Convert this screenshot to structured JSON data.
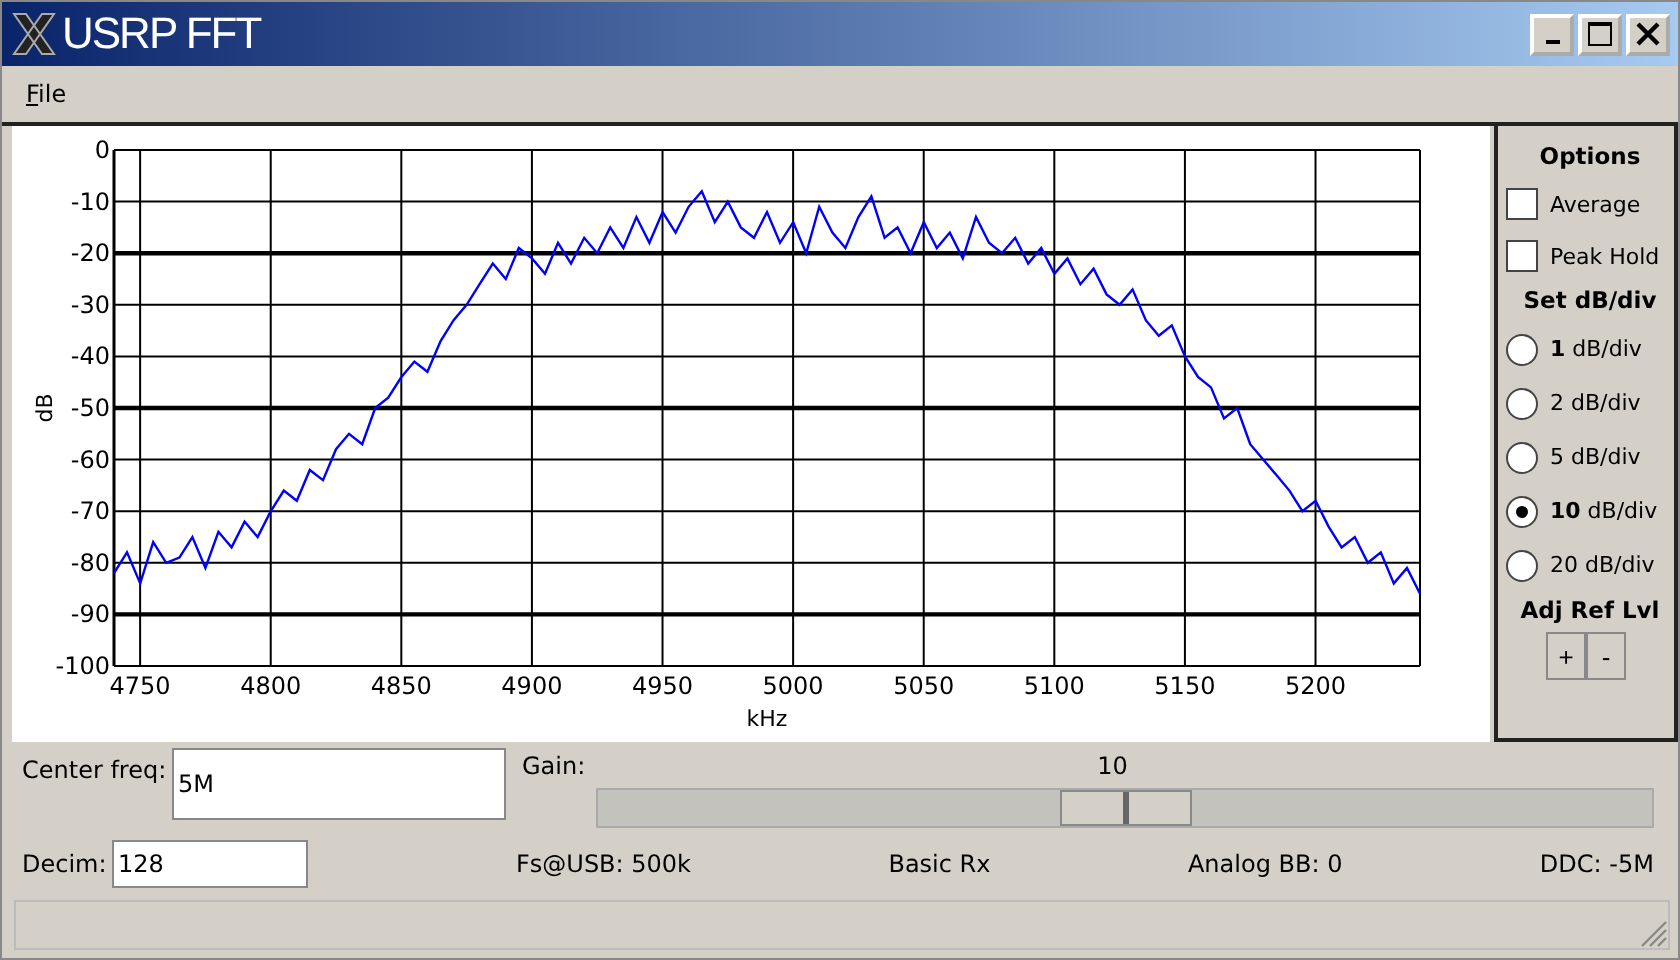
{
  "window": {
    "title": "USRP FFT"
  },
  "menu": [
    {
      "label": "File"
    }
  ],
  "chart_data": {
    "type": "line",
    "xlabel": "kHz",
    "ylabel": "dB",
    "x": [
      4740,
      4745,
      4750,
      4755,
      4760,
      4765,
      4770,
      4775,
      4780,
      4785,
      4790,
      4795,
      4800,
      4805,
      4810,
      4815,
      4820,
      4825,
      4830,
      4835,
      4840,
      4845,
      4850,
      4855,
      4860,
      4865,
      4870,
      4875,
      4880,
      4885,
      4890,
      4895,
      4900,
      4905,
      4910,
      4915,
      4920,
      4925,
      4930,
      4935,
      4940,
      4945,
      4950,
      4955,
      4960,
      4965,
      4970,
      4975,
      4980,
      4985,
      4990,
      4995,
      5000,
      5005,
      5010,
      5015,
      5020,
      5025,
      5030,
      5035,
      5040,
      5045,
      5050,
      5055,
      5060,
      5065,
      5070,
      5075,
      5080,
      5085,
      5090,
      5095,
      5100,
      5105,
      5110,
      5115,
      5120,
      5125,
      5130,
      5135,
      5140,
      5145,
      5150,
      5155,
      5160,
      5165,
      5170,
      5175,
      5180,
      5185,
      5190,
      5195,
      5200,
      5205,
      5210,
      5215,
      5220,
      5225,
      5230,
      5235,
      5240
    ],
    "grid": true,
    "series": [
      {
        "color": "#0000ff",
        "values": [
          -82,
          -78,
          -84,
          -76,
          -80,
          -79,
          -75,
          -81,
          -74,
          -77,
          -72,
          -75,
          -70,
          -66,
          -68,
          -62,
          -64,
          -58,
          -55,
          -57,
          -50,
          -48,
          -44,
          -41,
          -43,
          -37,
          -33,
          -30,
          -26,
          -22,
          -25,
          -19,
          -21,
          -24,
          -18,
          -22,
          -17,
          -20,
          -15,
          -19,
          -13,
          -18,
          -12,
          -16,
          -11,
          -8,
          -14,
          -10,
          -15,
          -17,
          -12,
          -18,
          -14,
          -20,
          -11,
          -16,
          -19,
          -13,
          -9,
          -17,
          -15,
          -20,
          -14,
          -19,
          -16,
          -21,
          -13,
          -18,
          -20,
          -17,
          -22,
          -19,
          -24,
          -21,
          -26,
          -23,
          -28,
          -30,
          -27,
          -33,
          -36,
          -34,
          -40,
          -44,
          -46,
          -52,
          -50,
          -57,
          -60,
          -63,
          -66,
          -70,
          -68,
          -73,
          -77,
          -75,
          -80,
          -78,
          -84,
          -81,
          -86
        ]
      }
    ],
    "xlim": [
      4740,
      5240
    ],
    "ylim": [
      -100,
      0
    ],
    "xticks": [
      4750,
      4800,
      4850,
      4900,
      4950,
      5000,
      5050,
      5100,
      5150,
      5200
    ],
    "yticks": [
      0,
      -10,
      -20,
      -30,
      -40,
      -50,
      -60,
      -70,
      -80,
      -90,
      -100
    ]
  },
  "options": {
    "title": "Options",
    "checkboxes": [
      {
        "label": "Average",
        "checked": false
      },
      {
        "label": "Peak Hold",
        "checked": false
      }
    ]
  },
  "db_div": {
    "title": "Set dB/div",
    "radios": [
      {
        "label": "**1** dB/div",
        "selected": false
      },
      {
        "label": "2 dB/div",
        "selected": false
      },
      {
        "label": "5 dB/div",
        "selected": false
      },
      {
        "label": "**10** dB/div",
        "selected": true
      },
      {
        "label": "20 dB/div",
        "selected": false
      }
    ]
  },
  "ref_level": {
    "title": "Adj Ref Lvl",
    "buttons": [
      "+",
      "-"
    ]
  },
  "center_freq": {
    "label": "Center freq:",
    "value": "5M"
  },
  "gain": {
    "label": "Gain:",
    "reading": "10",
    "level": 0.5
  },
  "decim": {
    "label": "Decim:",
    "value": "128"
  },
  "info": [
    "Fs@USB: 500k",
    "Basic Rx",
    "Analog BB: 0",
    "DDC: -5M"
  ]
}
